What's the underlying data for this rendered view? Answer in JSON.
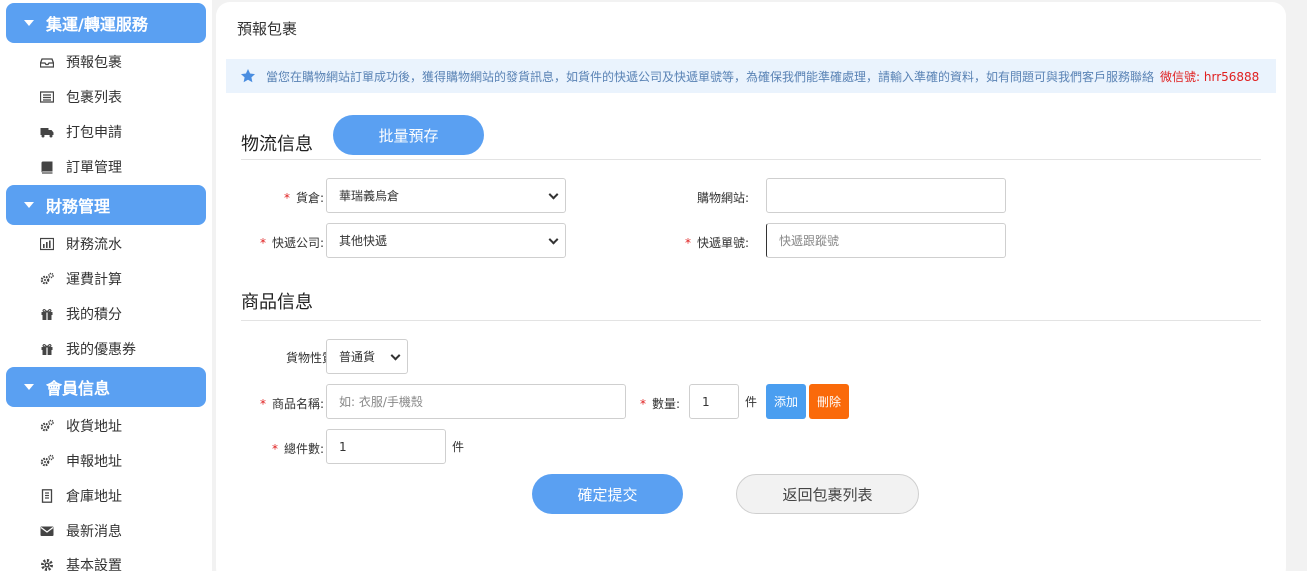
{
  "sidebar": {
    "groups": [
      {
        "title": "集運/轉運服務",
        "items": [
          {
            "label": "預報包裹",
            "icon": "inbox-icon"
          },
          {
            "label": "包裹列表",
            "icon": "list-icon"
          },
          {
            "label": "打包申請",
            "icon": "truck-icon"
          },
          {
            "label": "訂單管理",
            "icon": "book-icon"
          }
        ]
      },
      {
        "title": "財務管理",
        "items": [
          {
            "label": "財務流水",
            "icon": "bar-chart-icon"
          },
          {
            "label": "運費計算",
            "icon": "gears-icon"
          },
          {
            "label": "我的積分",
            "icon": "gift-icon"
          },
          {
            "label": "我的優惠券",
            "icon": "gift-icon"
          }
        ]
      },
      {
        "title": "會員信息",
        "items": [
          {
            "label": "收貨地址",
            "icon": "gears-icon"
          },
          {
            "label": "申報地址",
            "icon": "gears-icon"
          },
          {
            "label": "倉庫地址",
            "icon": "building-icon"
          },
          {
            "label": "最新消息",
            "icon": "envelope-icon"
          },
          {
            "label": "基本設置",
            "icon": "gear-icon"
          }
        ]
      }
    ]
  },
  "main": {
    "title": "預報包裹",
    "notice": {
      "text": "當您在購物網站訂單成功後，獲得購物網站的發貨訊息，如貨件的快遞公司及快遞單號等，為確保我們能準確處理，請輸入準確的資料，如有問題可與我們客戶服務聯絡",
      "wechat": "微信號: hrr56888"
    },
    "logistics": {
      "section_title": "物流信息",
      "batch_button": "批量預存",
      "warehouse_label": "貨倉:",
      "warehouse_value": "華瑞義烏倉",
      "site_label": "購物網站:",
      "site_value": "",
      "courier_label": "快遞公司:",
      "courier_value": "其他快遞",
      "tracking_label": "快遞單號:",
      "tracking_placeholder": "快遞跟蹤號"
    },
    "goods": {
      "section_title": "商品信息",
      "nature_label": "貨物性質:",
      "nature_value": "普通貨",
      "name_label": "商品名稱:",
      "name_placeholder": "如: 衣服/手機殼",
      "qty_label": "數量:",
      "qty_value": "1",
      "qty_unit": "件",
      "add_button": "添加",
      "delete_button": "刪除",
      "total_label": "總件數:",
      "total_value": "1",
      "total_unit": "件"
    },
    "actions": {
      "submit": "確定提交",
      "back": "返回包裹列表"
    }
  },
  "colors": {
    "accent": "#5aa0f2",
    "danger": "#fa6a0a",
    "required": "#e02020"
  }
}
